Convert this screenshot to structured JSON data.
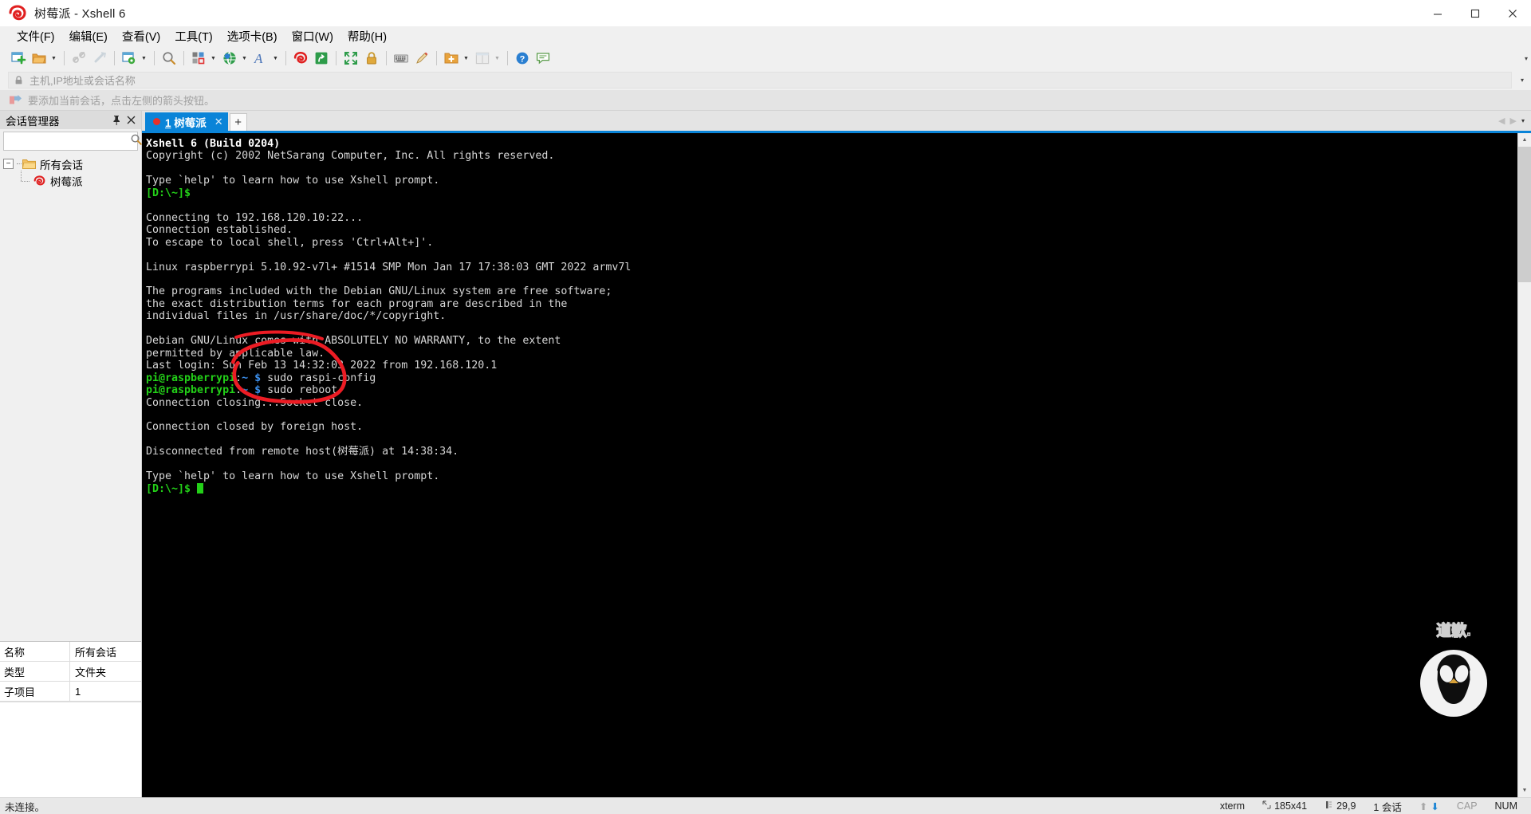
{
  "window": {
    "title": "树莓派 - Xshell 6",
    "icon": "xshell-logo-icon",
    "controls": {
      "minimize": "—",
      "maximize": "❐",
      "close": "✕"
    }
  },
  "menubar": {
    "items": [
      {
        "label": "文件(F)",
        "name": "menu-file"
      },
      {
        "label": "编辑(E)",
        "name": "menu-edit"
      },
      {
        "label": "查看(V)",
        "name": "menu-view"
      },
      {
        "label": "工具(T)",
        "name": "menu-tools"
      },
      {
        "label": "选项卡(B)",
        "name": "menu-tab"
      },
      {
        "label": "窗口(W)",
        "name": "menu-window"
      },
      {
        "label": "帮助(H)",
        "name": "menu-help"
      }
    ]
  },
  "toolbar": {
    "collapse_caret": "▾",
    "buttons": [
      "new-session-icon",
      "open-folder-icon",
      "disconnect-icon",
      "reconnect-icon",
      "session-properties-icon",
      "find-icon",
      "layout-icon",
      "globe-icon",
      "font-icon",
      "xshell-icon",
      "xftp-icon",
      "fullscreen-icon",
      "lock-icon",
      "keyboard-icon",
      "compose-icon",
      "transfer-icon",
      "window-split-icon",
      "help-icon",
      "feedback-icon"
    ]
  },
  "address_bar": {
    "lock_icon": "lock-icon",
    "placeholder": "主机,IP地址或会话名称",
    "value": "",
    "caret": "▾"
  },
  "hint_bar": {
    "icon": "arrow-hint-icon",
    "text": "要添加当前会话，点击左侧的箭头按钮。"
  },
  "sidebar": {
    "title": "会话管理器",
    "pin_icon": "pin-icon",
    "close_icon": "close-icon",
    "search": {
      "value": "",
      "placeholder": "",
      "icon": "search-icon"
    },
    "tree": [
      {
        "label": "所有会话",
        "icon": "folder-icon",
        "expander": "−",
        "level": 1,
        "name": "tree-item-all-sessions"
      },
      {
        "label": "树莓派",
        "icon": "xshell-session-icon",
        "level": 2,
        "name": "tree-item-raspberry-pi"
      }
    ],
    "properties": [
      {
        "key": "名称",
        "value": "所有会话"
      },
      {
        "key": "类型",
        "value": "文件夹"
      },
      {
        "key": "子项目",
        "value": "1"
      }
    ]
  },
  "tabbar": {
    "tabs": [
      {
        "index": "1",
        "label": "树莓派",
        "dot_color": "#e8302a",
        "close": "✕",
        "active": true
      }
    ],
    "add_label": "+",
    "nav_prev": "◀",
    "nav_next": "▶",
    "menu_caret": "▾"
  },
  "terminal": {
    "lines": [
      {
        "text": "Xshell 6 (Build 0204)",
        "style": "white-bold"
      },
      {
        "text": "Copyright (c) 2002 NetSarang Computer, Inc. All rights reserved.",
        "style": "normal"
      },
      {
        "text": "",
        "style": "normal"
      },
      {
        "text": "Type `help' to learn how to use Xshell prompt.",
        "style": "normal"
      },
      {
        "text": "[D:\\~]$",
        "style": "green"
      },
      {
        "text": "",
        "style": "normal"
      },
      {
        "text": "Connecting to 192.168.120.10:22...",
        "style": "normal"
      },
      {
        "text": "Connection established.",
        "style": "normal"
      },
      {
        "text": "To escape to local shell, press 'Ctrl+Alt+]'.",
        "style": "normal"
      },
      {
        "text": "",
        "style": "normal"
      },
      {
        "text": "Linux raspberrypi 5.10.92-v7l+ #1514 SMP Mon Jan 17 17:38:03 GMT 2022 armv7l",
        "style": "normal"
      },
      {
        "text": "",
        "style": "normal"
      },
      {
        "text": "The programs included with the Debian GNU/Linux system are free software;",
        "style": "normal"
      },
      {
        "text": "the exact distribution terms for each program are described in the",
        "style": "normal"
      },
      {
        "text": "individual files in /usr/share/doc/*/copyright.",
        "style": "normal"
      },
      {
        "text": "",
        "style": "normal"
      },
      {
        "text": "Debian GNU/Linux comes with ABSOLUTELY NO WARRANTY, to the extent",
        "style": "normal"
      },
      {
        "text": "permitted by applicable law.",
        "style": "normal"
      },
      {
        "text": "Last login: Sun Feb 13 14:32:03 2022 from 192.168.120.1",
        "style": "normal"
      }
    ],
    "prompt_lines": [
      {
        "host": "pi@raspberrypi",
        "colon": ":",
        "path": "~",
        "dollar": "$",
        "command": " sudo raspi-config"
      },
      {
        "host": "pi@raspberrypi",
        "colon": ":",
        "path": "~",
        "dollar": "$",
        "command": " sudo reboot"
      }
    ],
    "tail_lines": [
      {
        "text": "Connection closing...Socket close.",
        "style": "normal"
      },
      {
        "text": "",
        "style": "normal"
      },
      {
        "text": "Connection closed by foreign host.",
        "style": "normal"
      },
      {
        "text": "",
        "style": "normal"
      },
      {
        "text": "Disconnected from remote host(树莓派) at 14:38:34.",
        "style": "normal"
      },
      {
        "text": "",
        "style": "normal"
      },
      {
        "text": "Type `help' to learn how to use Xshell prompt.",
        "style": "normal"
      }
    ],
    "final_prompt": "[D:\\~]$",
    "colors": {
      "background": "#000000",
      "foreground": "#d6d6d6",
      "prompt_green": "#23d018",
      "prompt_blue": "#3b8eea",
      "annotation_red": "#ec1c24"
    },
    "watermark": {
      "text": "道歉.",
      "icon": "penguin-watermark-icon"
    }
  },
  "annotation": {
    "shape": "hand-drawn-ellipse",
    "color": "#ec1c24",
    "covers": "sudo raspi-config / sudo reboot prompt area"
  },
  "statusbar": {
    "connection_status": "未连接。",
    "terminal_type": "xterm",
    "size_icon": "resize-icon",
    "size": "185x41",
    "cursor_icon": "cursor-icon",
    "cursor_position": "29,9",
    "sessions": "1 会话",
    "upload_arrow": "⬆",
    "download_arrow": "⬇",
    "cap": "CAP",
    "num": "NUM"
  }
}
